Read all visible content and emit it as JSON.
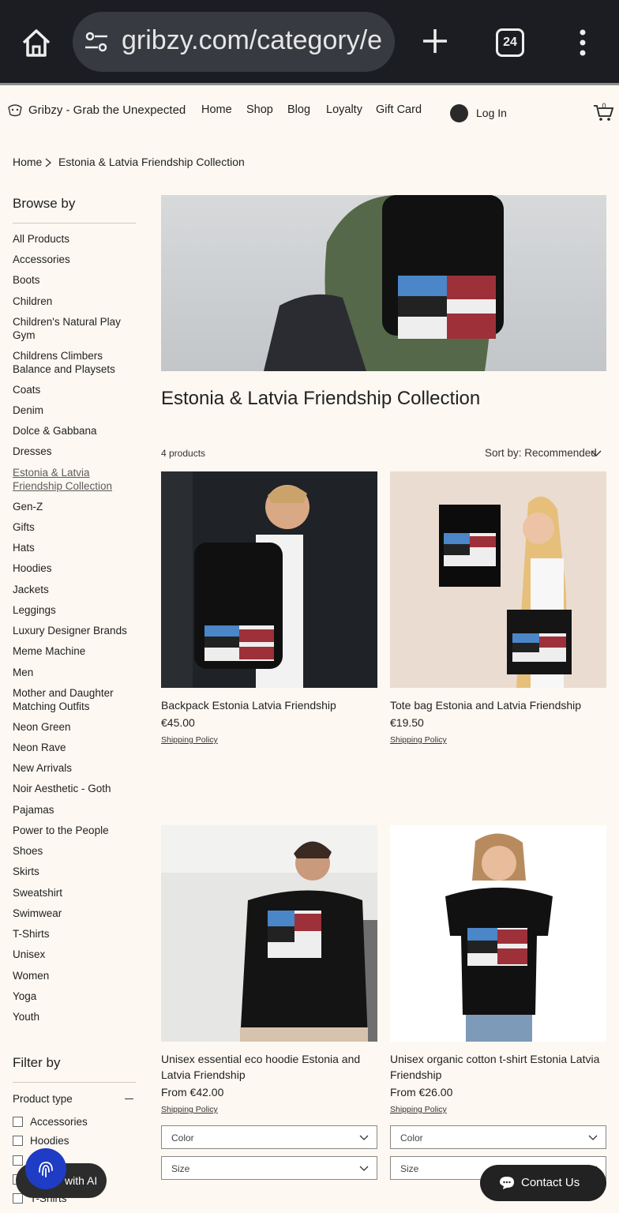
{
  "browser": {
    "url": "gribzy.com/category/e",
    "tab_count": "24"
  },
  "header": {
    "brand": "Gribzy - Grab the Unexpected",
    "nav": [
      "Home",
      "Shop",
      "Blog",
      "Loyalty",
      "Gift Card"
    ],
    "login": "Log In",
    "cart_count": "0"
  },
  "breadcrumb": {
    "home": "Home",
    "current": "Estonia & Latvia Friendship Collection"
  },
  "sidebar": {
    "browse_title": "Browse by",
    "categories": [
      "All Products",
      "Accessories",
      "Boots",
      "Children",
      "Children's Natural Play Gym",
      "Childrens Climbers Balance and Playsets",
      "Coats",
      "Denim",
      "Dolce & Gabbana",
      "Dresses",
      "Estonia & Latvia Friendship Collection",
      "Gen-Z",
      "Gifts",
      "Hats",
      "Hoodies",
      "Jackets",
      "Leggings",
      "Luxury Designer Brands",
      "Meme Machine",
      "Men",
      "Mother and Daughter Matching Outfits",
      "Neon Green",
      "Neon Rave",
      "New Arrivals",
      "Noir Aesthetic - Goth",
      "Pajamas",
      "Power to the People",
      "Shoes",
      "Skirts",
      "Sweatshirt",
      "Swimwear",
      "T-Shirts",
      "Unisex",
      "Women",
      "Yoga",
      "Youth"
    ],
    "filter_title": "Filter by",
    "product_type_label": "Product type",
    "product_types": [
      "Accessories",
      "Hoodies",
      "",
      "",
      "T-Shirts"
    ]
  },
  "main": {
    "title": "Estonia & Latvia Friendship Collection",
    "count": "4 products",
    "sort": "Sort by: Recommended"
  },
  "products": [
    {
      "name": "Backpack Estonia Latvia Friendship",
      "price": "€45.00",
      "shipping": "Shipping Policy"
    },
    {
      "name": "Tote bag Estonia and Latvia Friendship",
      "price": "€19.50",
      "shipping": "Shipping Policy"
    },
    {
      "name": "Unisex essential eco hoodie Estonia and Latvia Friendship",
      "price": "From €42.00",
      "shipping": "Shipping Policy",
      "options": [
        "Color",
        "Size"
      ]
    },
    {
      "name": "Unisex organic cotton t-shirt Estonia Latvia Friendship",
      "price": "From €26.00",
      "shipping": "Shipping Policy",
      "options": [
        "Color",
        "Size"
      ]
    }
  ],
  "floating": {
    "ai_label": "with AI",
    "contact": "Contact Us"
  },
  "colors": {
    "page_bg": "#fdf8f1",
    "estonia_blue": "#4a86c8",
    "latvia_red": "#9e3039",
    "ai_blue": "#1e3cc4"
  }
}
